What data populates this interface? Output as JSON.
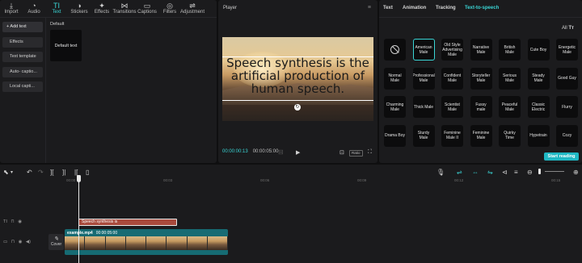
{
  "top_nav": [
    {
      "label": "Import",
      "icon": "import-icon",
      "glyph": "⤓"
    },
    {
      "label": "Audio",
      "icon": "audio-icon",
      "glyph": "◔"
    },
    {
      "label": "Text",
      "icon": "text-icon",
      "glyph": "TI"
    },
    {
      "label": "Stickers",
      "icon": "stickers-icon",
      "glyph": "◑"
    },
    {
      "label": "Effects",
      "icon": "effects-icon",
      "glyph": "✦"
    },
    {
      "label": "Transitions",
      "icon": "transitions-icon",
      "glyph": "⋈"
    },
    {
      "label": "Captions",
      "icon": "captions-icon",
      "glyph": "▭"
    },
    {
      "label": "Filters",
      "icon": "filters-icon",
      "glyph": "◎"
    },
    {
      "label": "Adjustment",
      "icon": "adjustment-icon",
      "glyph": "⇌"
    }
  ],
  "text_sidebar": [
    "+ Add text",
    "Effects",
    "Text template",
    "Auto- captio...",
    "Local capti..."
  ],
  "text_library": {
    "section": "Default",
    "tile_label": "Default text"
  },
  "player": {
    "title": "Player",
    "caption": "Speech synthesis is the artificial production of human speech.",
    "time_current": "00:00:00:13",
    "time_total": "00:00:05:00",
    "ratio_label": "Ratio"
  },
  "right_panel": {
    "tabs": [
      "Text",
      "Animation",
      "Tracking",
      "Text-to-speech"
    ],
    "filter_label": "All",
    "voices": [
      "",
      "American Male",
      "Old Style Advertising Male",
      "Narrative Male",
      "British Male",
      "Cute Boy",
      "Energetic Male",
      "Normal Male",
      "Professional Male",
      "Confident Male",
      "Storyteller Male",
      "Serious Male",
      "Steady Male",
      "Good Guy",
      "Charming Male",
      "Thick Male",
      "Scientist Male",
      "Fussy male",
      "Peaceful Male",
      "Classic Electric",
      "Flurry",
      "Drama Boy",
      "Sturdy Male",
      "Feminine Male II",
      "Feminine Male",
      "Quirky Time",
      "Hypetrain",
      "Cozy"
    ],
    "selected_voice": "American Male",
    "start_button": "Start reading",
    "accent_color": "#3ad6d6"
  },
  "timeline": {
    "ruler_labels": [
      "00:00",
      "00:03",
      "00:06",
      "00:09",
      "00:12",
      "00:15"
    ],
    "text_clip_label": "Speech synthesis is",
    "video_clip_name": "example.mp4",
    "video_clip_duration": "00:00:05:00",
    "cover_label": "Cover"
  }
}
